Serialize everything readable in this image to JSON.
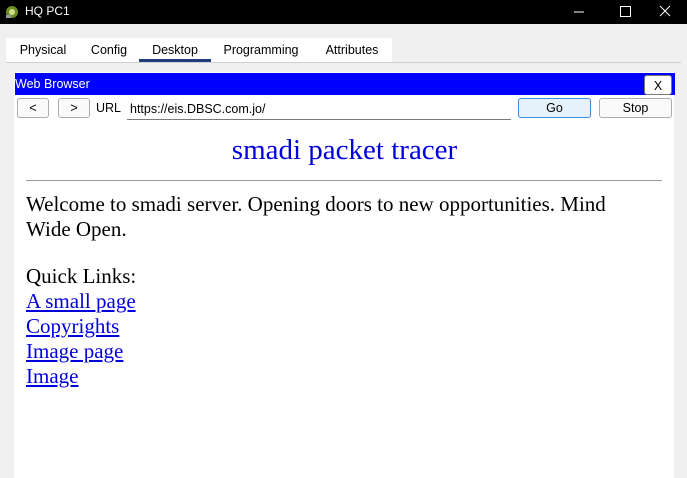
{
  "window": {
    "title": "HQ PC1",
    "controls": [
      "minimize",
      "maximize",
      "close"
    ]
  },
  "tabs": [
    {
      "label": "Physical",
      "active": false
    },
    {
      "label": "Config",
      "active": false
    },
    {
      "label": "Desktop",
      "active": true
    },
    {
      "label": "Programming",
      "active": false
    },
    {
      "label": "Attributes",
      "active": false
    }
  ],
  "browser": {
    "header_label": "Web Browser",
    "close_label": "X",
    "back_label": "<",
    "forward_label": ">",
    "url_label": "URL",
    "url_value": "https://eis.DBSC.com.jo/",
    "go_label": "Go",
    "stop_label": "Stop",
    "accent_color": "#0000ff"
  },
  "page": {
    "title": "smadi packet tracer",
    "welcome": "Welcome to smadi server. Opening doors to new opportunities. Mind Wide Open.",
    "quick_links_label": "Quick Links:",
    "links": [
      "A small page",
      "Copyrights",
      "Image page",
      "Image"
    ]
  }
}
